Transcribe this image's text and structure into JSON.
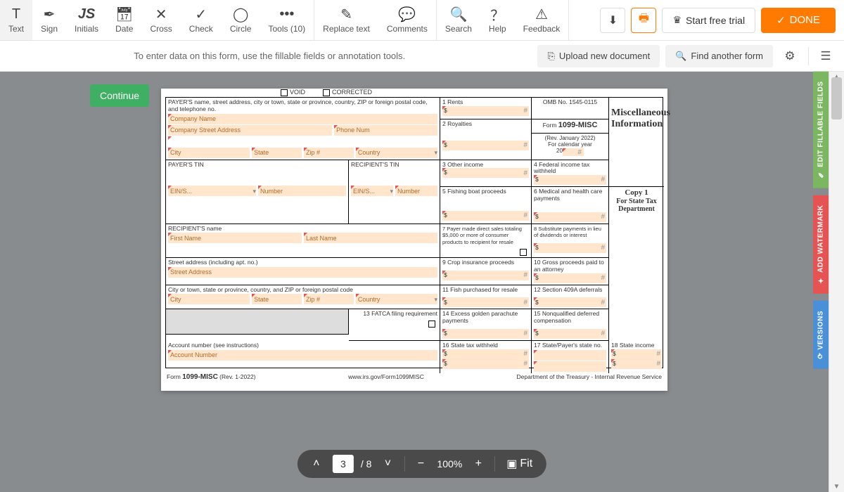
{
  "toolbar": {
    "text": "Text",
    "sign": "Sign",
    "initials": "Initials",
    "date": "Date",
    "cross": "Cross",
    "check": "Check",
    "circle": "Circle",
    "tools": "Tools (10)",
    "replace": "Replace text",
    "comments": "Comments",
    "search": "Search",
    "help": "Help",
    "feedback": "Feedback",
    "trial": "Start free trial",
    "done": "DONE"
  },
  "subbar": {
    "hint": "To enter data on this form, use the fillable fields or annotation tools.",
    "upload": "Upload new document",
    "find": "Find another form"
  },
  "continue": "Continue",
  "side": {
    "fill": "EDIT FILLABLE FIELDS",
    "wm": "ADD WATERMARK",
    "ver": "VERSIONS"
  },
  "nav": {
    "page": "3",
    "total": "/ 8",
    "zoom": "100%",
    "fit": "Fit"
  },
  "form": {
    "void": "VOID",
    "corrected": "CORRECTED",
    "payer_header": "PAYER'S name, street address, city or town, state or province, country, ZIP or foreign postal code, and telephone no.",
    "company_name": "Company Name",
    "company_street": "Company Street Address",
    "phone": "Phone Num",
    "city": "City",
    "state": "State",
    "zip": "Zip #",
    "country": "Country",
    "payer_tin": "PAYER'S TIN",
    "recipient_tin": "RECIPIENT'S TIN",
    "ein": "EIN/S...",
    "number": "Number",
    "recipient_name": "RECIPIENT'S name",
    "first_name": "First Name",
    "last_name": "Last Name",
    "street_header": "Street address (including apt. no.)",
    "street": "Street Address",
    "cityline_header": "City or town, state or province, country, and ZIP or foreign postal code",
    "account_header": "Account number (see instructions)",
    "account_number": "Account Number",
    "box1": "1 Rents",
    "box2": "2 Royalties",
    "box3": "3 Other income",
    "box4": "4 Federal income tax withheld",
    "box5": "5 Fishing boat proceeds",
    "box6": "6 Medical and health care payments",
    "box7": "7 Payer made direct sales totaling $5,000 or more of consumer products to recipient for resale",
    "box8": "8 Substitute payments in lieu of dividends or interest",
    "box9": "9 Crop insurance proceeds",
    "box10": "10 Gross proceeds paid to an attorney",
    "box11": "11 Fish purchased for resale",
    "box12": "12 Section 409A deferrals",
    "box13": "13 FATCA filing requirement",
    "box14": "14 Excess golden parachute payments",
    "box15": "15 Nonqualified deferred compensation",
    "box16": "16 State tax withheld",
    "box17": "17 State/Payer's state no.",
    "box18": "18 State income",
    "omb": "OMB No. 1545-0115",
    "form_no": "1099-MISC",
    "form_lbl": "Form",
    "rev": "(Rev. January 2022)",
    "cal": "For calendar year",
    "yr_prefix": "20",
    "title": "Miscellaneous Information",
    "copy": "Copy 1",
    "for_state": "For State Tax Department",
    "footer_form": "Form",
    "footer_rev": "(Rev. 1-2022)",
    "footer_url": "www.irs.gov/Form1099MISC",
    "footer_dept": "Department of the Treasury - Internal Revenue Service"
  }
}
